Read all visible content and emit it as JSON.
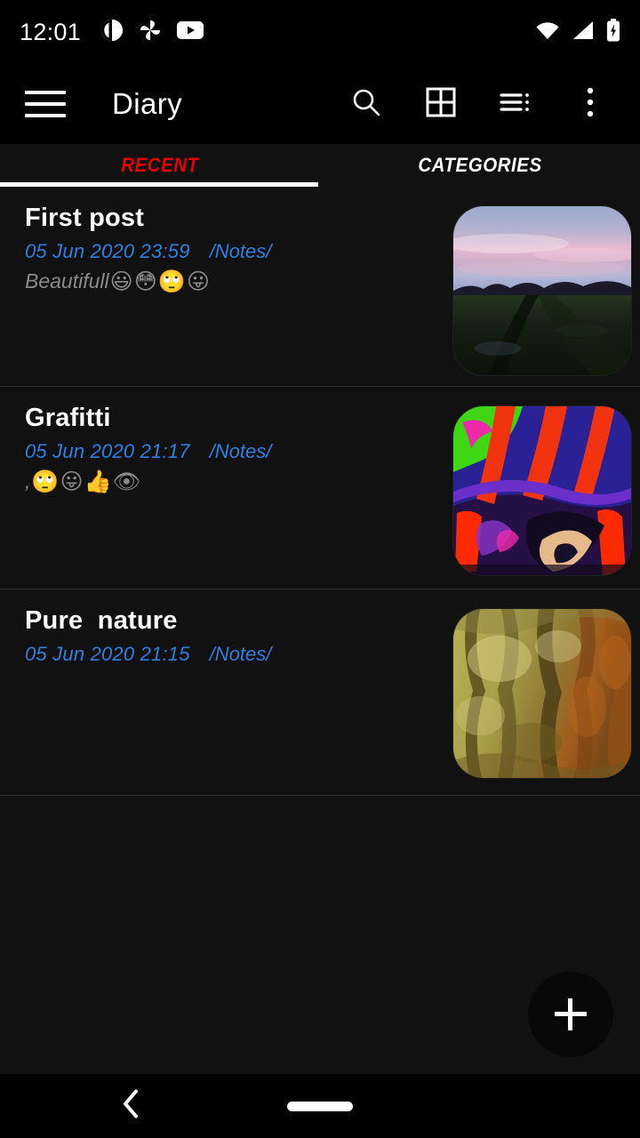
{
  "status_bar": {
    "clock": "12:01",
    "left_icons": [
      "notification-circle-icon",
      "pinwheel-icon",
      "youtube-icon"
    ],
    "right_icons": [
      "wifi-icon",
      "cellular-signal-icon",
      "battery-charging-icon"
    ]
  },
  "toolbar": {
    "menu_icon": "hamburger-menu-icon",
    "title": "Diary",
    "actions": [
      {
        "name": "search-icon"
      },
      {
        "name": "grid-view-icon"
      },
      {
        "name": "sort-list-icon"
      },
      {
        "name": "overflow-menu-icon"
      }
    ]
  },
  "tabs": {
    "items": [
      {
        "label": "RECENT",
        "selected": true,
        "color": "#e60000"
      },
      {
        "label": "CATEGORIES",
        "selected": false,
        "color": "#ffffff"
      }
    ],
    "indicator_color": "#ffffff"
  },
  "entries": [
    {
      "title": "First post",
      "date": "05 Jun 2020 23:59",
      "path": "/Notes/",
      "preview_text": "Beautifull ",
      "preview_emoji": [
        "😃",
        "😳",
        "🙄",
        "😛"
      ],
      "thumbnail": "field-at-dusk-photo"
    },
    {
      "title": "Grafitti",
      "date": "05 Jun 2020 21:17",
      "path": "/Notes/",
      "preview_text": ", ",
      "preview_emoji": [
        "🙄",
        "😛",
        "👍",
        "👁"
      ],
      "thumbnail": "graffiti-wall-photo"
    },
    {
      "title": "Pure  nature",
      "date": "05 Jun 2020 21:15",
      "path": "/Notes/",
      "preview_text": "",
      "preview_emoji": [],
      "thumbnail": "tree-bark-photo"
    }
  ],
  "fab": {
    "name": "add-entry-fab",
    "icon": "plus-icon"
  },
  "nav_bar": {
    "back_icon": "back-chevron-icon",
    "home_indicator": "home-pill-indicator"
  },
  "colors": {
    "background": "#111111",
    "toolbar_background": "#000000",
    "accent_red": "#e60000",
    "link_blue": "#2f7fe0",
    "preview_gray": "#8a8a8a",
    "divider": "#2b2b2b"
  }
}
